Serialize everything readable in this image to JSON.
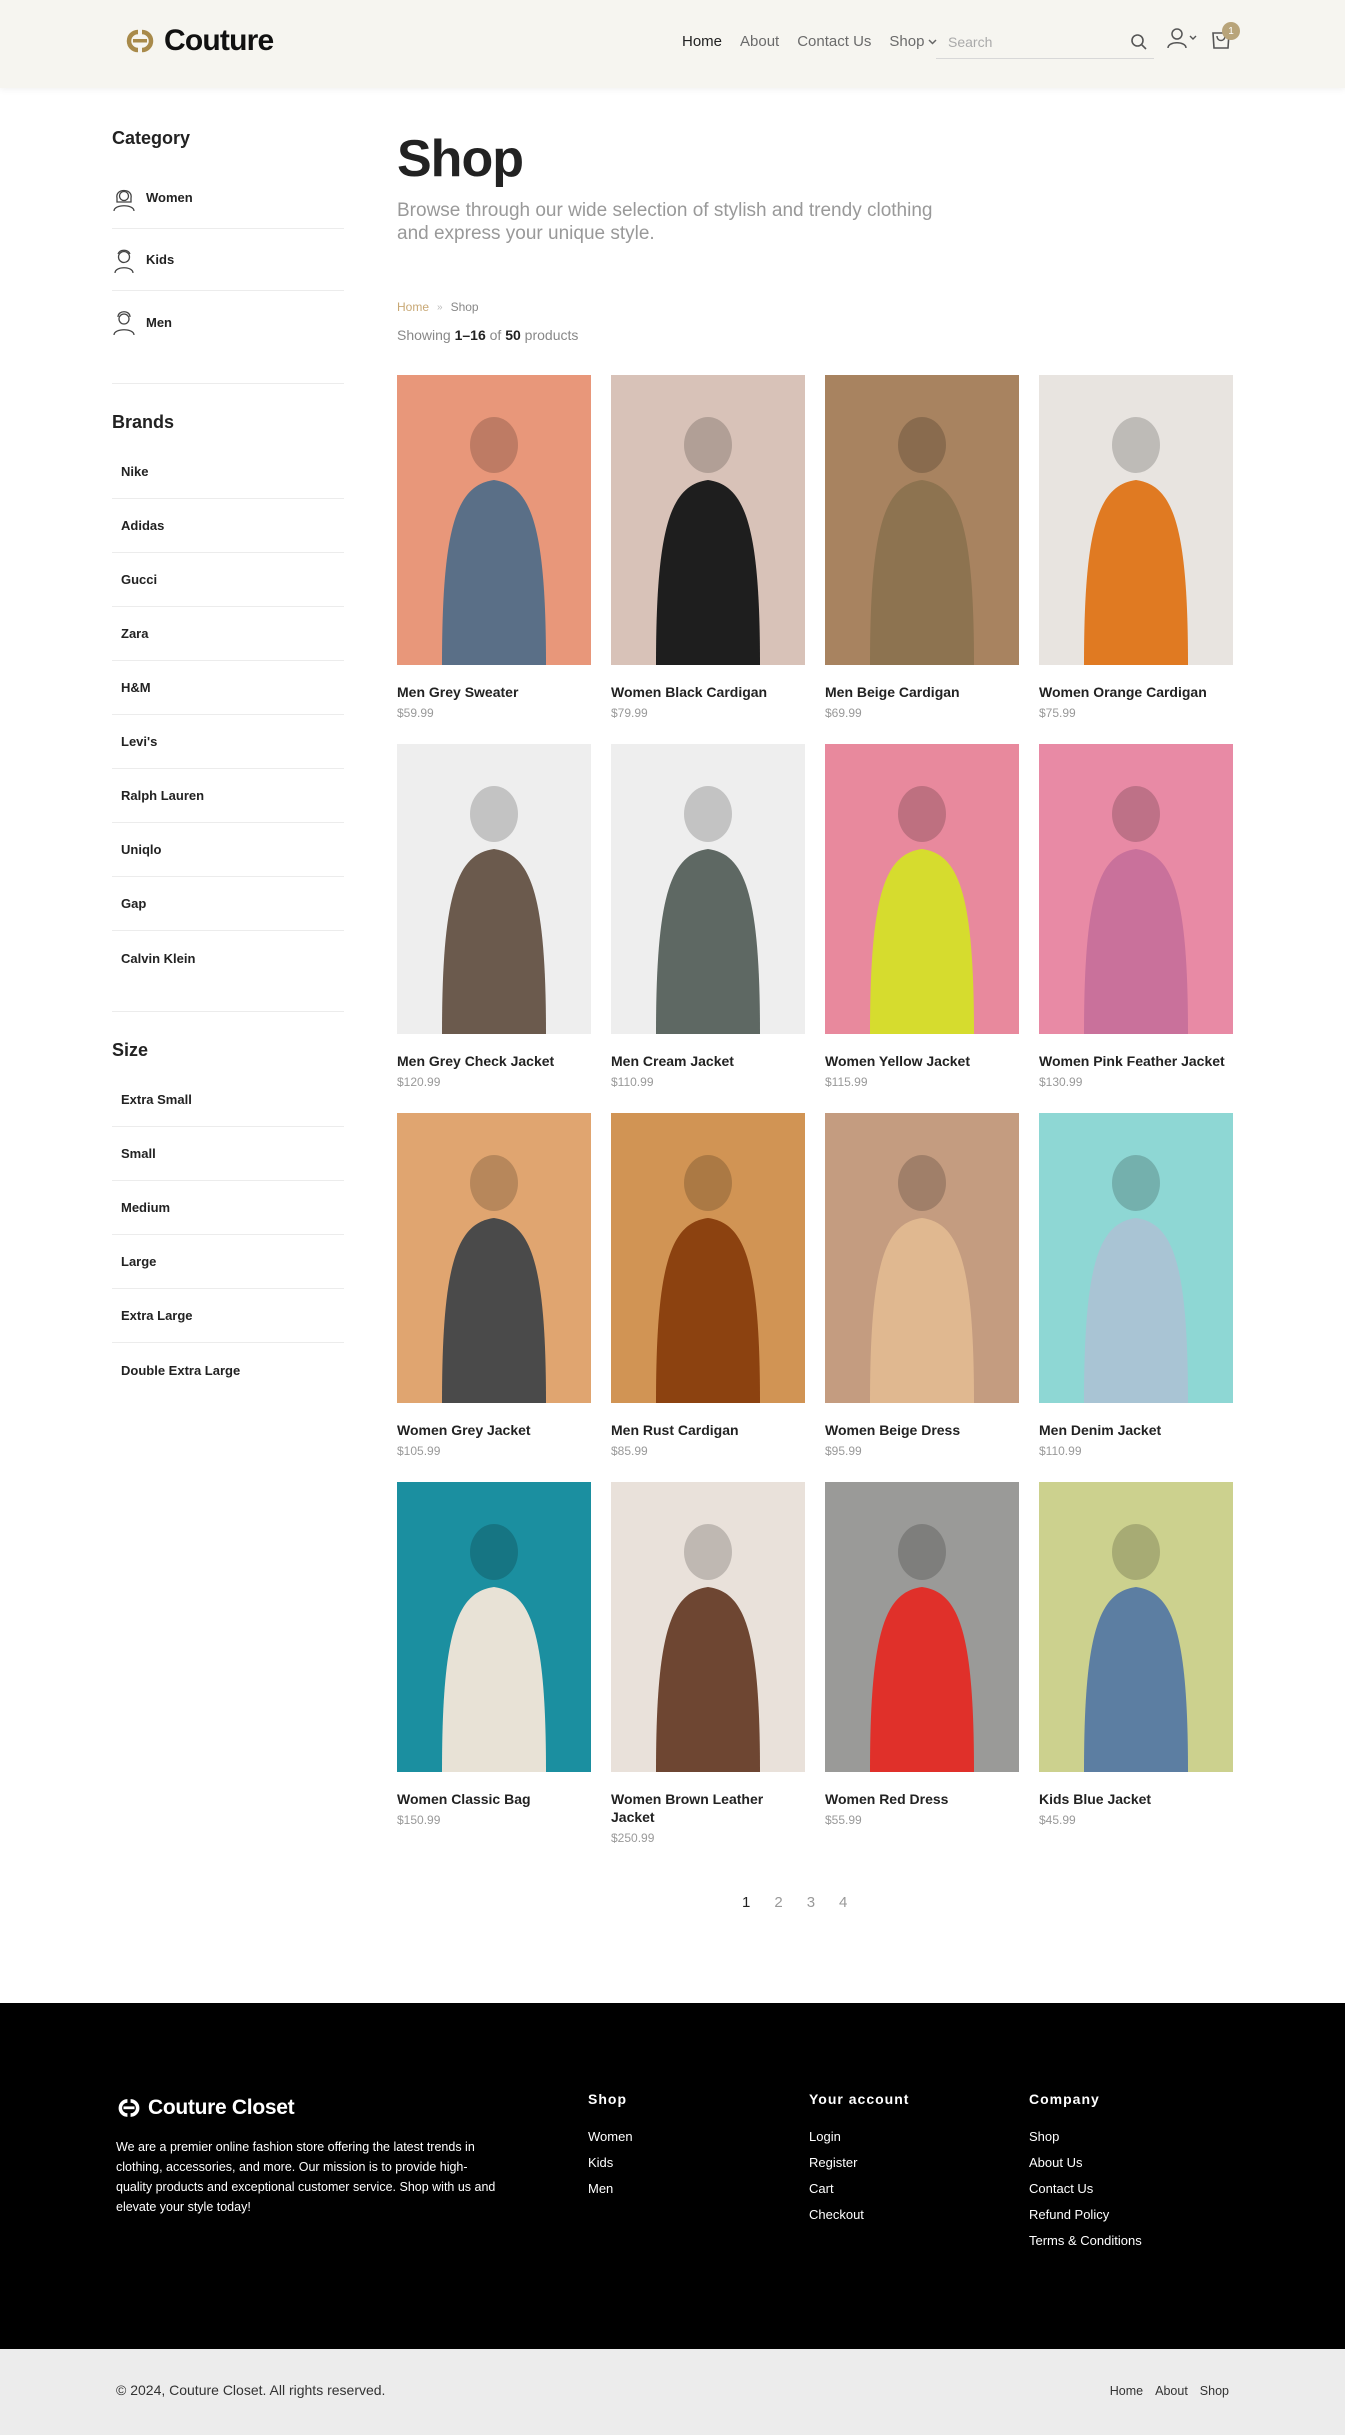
{
  "brand": {
    "name": "Couture"
  },
  "nav": {
    "items": [
      "Home",
      "About",
      "Contact Us"
    ],
    "shop_label": "Shop",
    "search_placeholder": "Search",
    "cart_count": "1"
  },
  "sidebar": {
    "category_heading": "Category",
    "categories": [
      "Women",
      "Kids",
      "Men"
    ],
    "brands_heading": "Brands",
    "brands": [
      "Nike",
      "Adidas",
      "Gucci",
      "Zara",
      "H&M",
      "Levi's",
      "Ralph Lauren",
      "Uniqlo",
      "Gap",
      "Calvin Klein"
    ],
    "size_heading": "Size",
    "sizes": [
      "Extra Small",
      "Small",
      "Medium",
      "Large",
      "Extra Large",
      "Double Extra Large"
    ]
  },
  "main": {
    "title": "Shop",
    "subtitle": "Browse through our wide selection of stylish and trendy clothing and express your unique style.",
    "breadcrumb": {
      "home": "Home",
      "separator": "»",
      "current": "Shop"
    },
    "showing": {
      "prefix": "Showing ",
      "range": "1–16",
      "middle": " of ",
      "total": "50",
      "suffix": " products"
    }
  },
  "products": [
    {
      "name": "Men Grey Sweater",
      "price": "$59.99",
      "bg": "#e8977a",
      "fg": "#5a6f87"
    },
    {
      "name": "Women Black Cardigan",
      "price": "$79.99",
      "bg": "#d8c2b8",
      "fg": "#1e1e1e"
    },
    {
      "name": "Men Beige Cardigan",
      "price": "$69.99",
      "bg": "#a88360",
      "fg": "#8d7350"
    },
    {
      "name": "Women Orange Cardigan",
      "price": "$75.99",
      "bg": "#e8e4e0",
      "fg": "#e07a22"
    },
    {
      "name": "Men Grey Check Jacket",
      "price": "$120.99",
      "bg": "#eeeeee",
      "fg": "#6b5a4d"
    },
    {
      "name": "Men Cream Jacket",
      "price": "$110.99",
      "bg": "#eeeeee",
      "fg": "#5e6863"
    },
    {
      "name": "Women Yellow Jacket",
      "price": "$115.99",
      "bg": "#e8899d",
      "fg": "#d6dc2e"
    },
    {
      "name": "Women Pink Feather Jacket",
      "price": "$130.99",
      "bg": "#e88aa5",
      "fg": "#c9719b"
    },
    {
      "name": "Women Grey Jacket",
      "price": "$105.99",
      "bg": "#e0a570",
      "fg": "#4a4a4a"
    },
    {
      "name": "Men Rust Cardigan",
      "price": "$85.99",
      "bg": "#d19454",
      "fg": "#8c4210"
    },
    {
      "name": "Women Beige Dress",
      "price": "$95.99",
      "bg": "#c49c80",
      "fg": "#e0b890"
    },
    {
      "name": "Men Denim Jacket",
      "price": "$110.99",
      "bg": "#8ed7d4",
      "fg": "#a9c4d4"
    },
    {
      "name": "Women Classic Bag",
      "price": "$150.99",
      "bg": "#1b8fa0",
      "fg": "#e8e2d6"
    },
    {
      "name": "Women Brown Leather Jacket",
      "price": "$250.99",
      "bg": "#e9e1da",
      "fg": "#6e4632"
    },
    {
      "name": "Women Red Dress",
      "price": "$55.99",
      "bg": "#9a9a98",
      "fg": "#e0302a"
    },
    {
      "name": "Kids Blue Jacket",
      "price": "$45.99",
      "bg": "#ccd18e",
      "fg": "#5c7ea2"
    }
  ],
  "pagination": [
    "1",
    "2",
    "3",
    "4"
  ],
  "footer": {
    "brand": "Couture Closet",
    "about": "We are a premier online fashion store offering the latest trends in clothing, accessories, and more. Our mission is to provide high-quality products and exceptional customer service. Shop with us and elevate your style today!",
    "columns": [
      {
        "heading": "Shop",
        "links": [
          "Women",
          "Kids",
          "Men"
        ]
      },
      {
        "heading": "Your account",
        "links": [
          "Login",
          "Register",
          "Cart",
          "Checkout"
        ]
      },
      {
        "heading": "Company",
        "links": [
          "Shop",
          "About Us",
          "Contact Us",
          "Refund Policy",
          "Terms & Conditions"
        ]
      }
    ],
    "copyright": "© 2024, Couture Closet. All rights reserved.",
    "bottom_links": [
      "Home",
      "About",
      "Shop"
    ]
  },
  "colors": {
    "accent": "#b8a47a",
    "gold_logo": "#a88a4a",
    "header_bg": "#f6f5f0",
    "footer_bg": "#000000",
    "bottom_bg": "#ececec"
  },
  "icons": [
    "logo-cc-icon",
    "search-icon",
    "user-icon",
    "chevron-down-icon",
    "cart-icon",
    "women-icon",
    "kids-icon",
    "men-icon"
  ]
}
